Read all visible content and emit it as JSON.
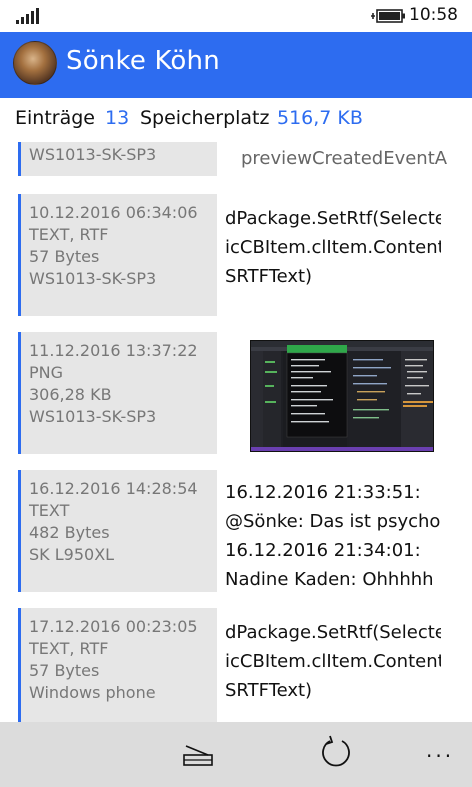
{
  "status_bar": {
    "time": "10:58",
    "signal_icon": "signal-bars-icon",
    "battery_icon": "battery-charging-icon"
  },
  "header": {
    "user_name": "Sönke Köhn",
    "avatar_icon": "user-avatar-photo"
  },
  "summary": {
    "entries_label": "Einträge",
    "entries_count": "13",
    "storage_label": "Speicherplatz",
    "storage_value": "516,7 KB"
  },
  "colors": {
    "accent": "#2d6cf0",
    "meta_bg": "#e6e6e6",
    "appbar_bg": "#dcdcdc",
    "meta_text": "#777777"
  },
  "entries": [
    {
      "meta": [
        "WS1013-SK-SP3"
      ],
      "content": [
        "previewCreatedEventA"
      ]
    },
    {
      "meta": [
        "10.12.2016 06:34:06",
        "TEXT, RTF",
        "57 Bytes",
        "WS1013-SK-SP3"
      ],
      "content": [
        "dPackage.SetRtf(Selecte",
        "icCBItem.clItem.Content",
        "SRTFText)"
      ]
    },
    {
      "meta": [
        "11.12.2016 13:37:22",
        "PNG",
        "306,28 KB",
        "WS1013-SK-SP3"
      ],
      "content": [],
      "thumbnail": "screenshot-thumbnail"
    },
    {
      "meta": [
        "16.12.2016 14:28:54",
        "TEXT",
        "482 Bytes",
        "SK L950XL"
      ],
      "content": [
        "16.12.2016 21:33:51:",
        "@Sönke: Das ist psycho",
        "16.12.2016 21:34:01:",
        "Nadine Kaden: Ohhhhh"
      ]
    },
    {
      "meta": [
        "17.12.2016 00:23:05",
        "TEXT, RTF",
        "57 Bytes",
        "Windows phone"
      ],
      "content": [
        "dPackage.SetRtf(Selecte",
        "icCBItem.clItem.Content",
        "SRTFText)"
      ]
    }
  ],
  "app_bar": {
    "scan_icon": "scanner-icon",
    "refresh_icon": "refresh-icon",
    "more_icon": "more-ellipsis-icon",
    "more_label": "..."
  }
}
